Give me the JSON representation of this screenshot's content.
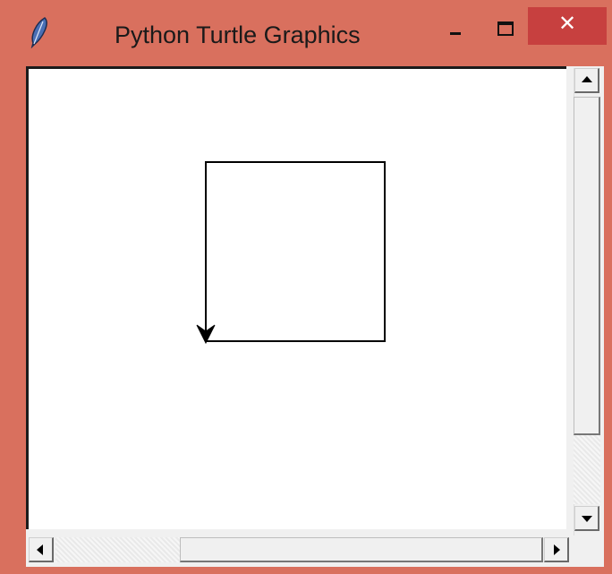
{
  "window": {
    "title": "Python Turtle Graphics",
    "icon": "feather-icon",
    "frame_color": "#d9705e",
    "close_button_color": "#c7403f",
    "controls": {
      "minimize_icon": "minimize-icon",
      "maximize_icon": "maximize-icon",
      "close_label": "✕"
    }
  },
  "canvas": {
    "background": "#ffffff",
    "pen_color": "#000000",
    "shapes": [
      "square-path",
      "turtle-arrow-cursor"
    ],
    "turtle_heading": "down"
  },
  "scrollbars": {
    "vertical": {
      "icons": [
        "arrow-up-icon",
        "arrow-down-icon"
      ]
    },
    "horizontal": {
      "icons": [
        "arrow-left-icon",
        "arrow-right-icon"
      ]
    }
  }
}
